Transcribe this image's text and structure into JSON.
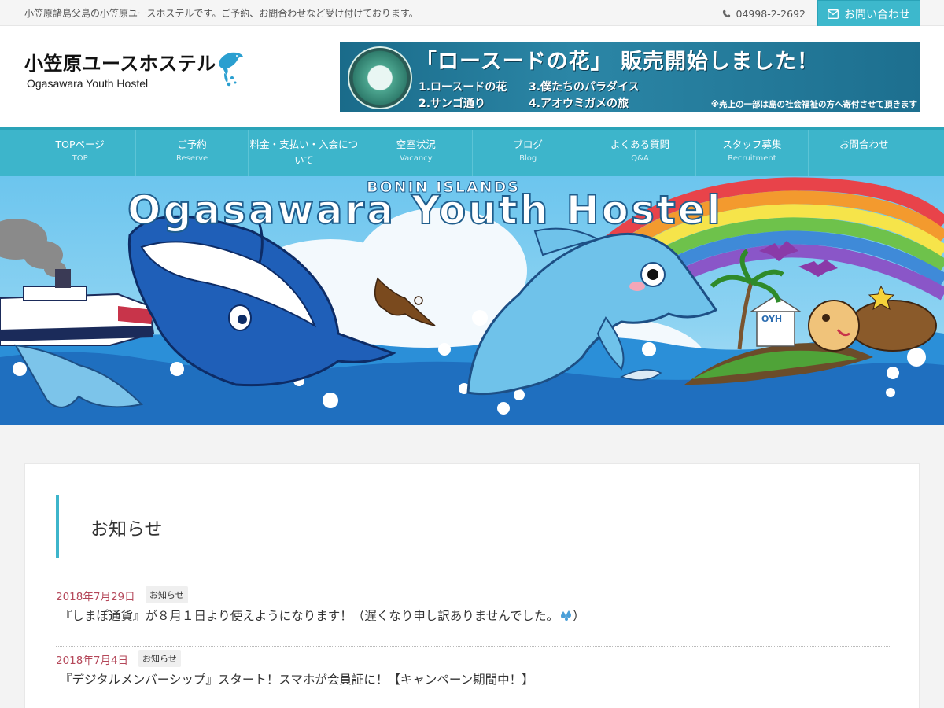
{
  "topbar": {
    "tagline": "小笠原諸島父島の小笠原ユースホステルです。ご予約、お問合わせなど受け付けております。",
    "phone": "04998-2-2692",
    "contact_label": "お問い合わせ"
  },
  "logo": {
    "title": "小笠原ユースホステル",
    "subtitle": "Ogasawara Youth Hostel"
  },
  "banner": {
    "title": "「ロースードの花」 販売開始しました！",
    "items": [
      "1.ロースードの花",
      "3.僕たちのパラダイス",
      "2.サンゴ通り",
      "4.アオウミガメの旅"
    ],
    "note": "※売上の一部は島の社会福祉の方へ寄付させて頂きます"
  },
  "nav": {
    "items": [
      {
        "label": "TOPページ",
        "sub": "TOP"
      },
      {
        "label": "ご予約",
        "sub": "Reserve"
      },
      {
        "label": "料金・支払い・入会について",
        "sub": ""
      },
      {
        "label": "空室状況",
        "sub": "Vacancy"
      },
      {
        "label": "ブログ",
        "sub": "Blog"
      },
      {
        "label": "よくある質問",
        "sub": "Q&A"
      },
      {
        "label": "スタッフ募集",
        "sub": "Recruitment"
      },
      {
        "label": "お問合わせ",
        "sub": ""
      }
    ]
  },
  "hero": {
    "small_title": "BONIN ISLANDS",
    "big_title": "Ogasawara Youth Hostel",
    "house_sign": "OYH"
  },
  "news": {
    "heading": "お知らせ",
    "items": [
      {
        "date": "2018年7月29日",
        "tag": "お知らせ",
        "title": "『しまぽ通貨』が８月１日より使えようになります！（遅くなり申し訳ありませんでした。",
        "title_end": "）"
      },
      {
        "date": "2018年7月4日",
        "tag": "お知らせ",
        "title": "『デジタルメンバーシップ』スタート！スマホが会員証に！【キャンペーン期間中！】",
        "title_end": ""
      }
    ]
  },
  "colors": {
    "accent": "#3db5cb",
    "date": "#b5485a"
  }
}
